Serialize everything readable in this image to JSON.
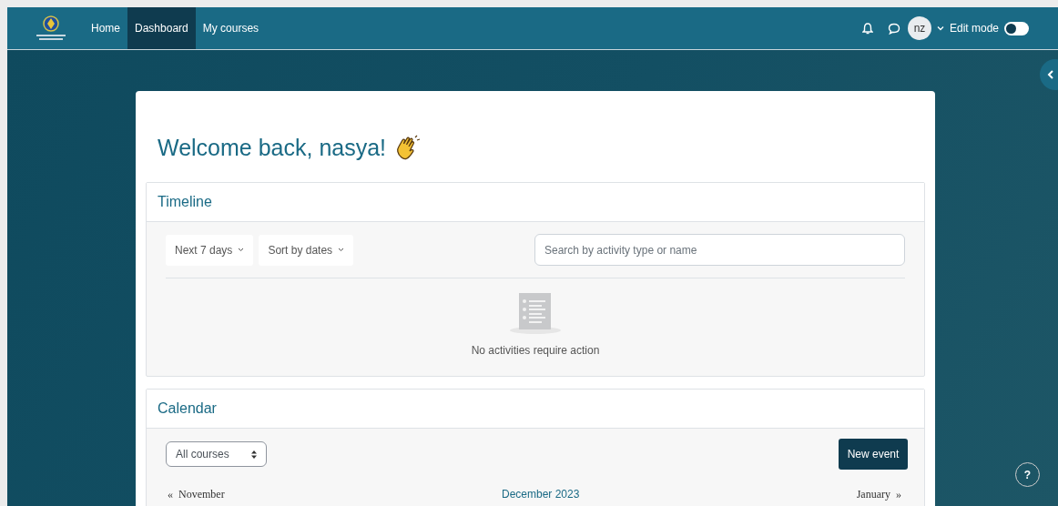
{
  "navbar": {
    "items": [
      {
        "label": "Home",
        "selected": false
      },
      {
        "label": "Dashboard",
        "selected": true
      },
      {
        "label": "My courses",
        "selected": false
      }
    ],
    "avatar": "nz",
    "edit_mode": {
      "label": "Edit mode",
      "on": false
    }
  },
  "welcome": "Welcome back, nasya!",
  "timeline": {
    "title": "Timeline",
    "filters": [
      "Next 7 days",
      "Sort by dates"
    ],
    "search": {
      "placeholder": "Search by activity type or name"
    },
    "empty_message": "No activities require action"
  },
  "calendar": {
    "title": "Calendar",
    "course_select": "All courses",
    "new_event": "New event",
    "prev": "«  November",
    "current": "December 2023",
    "next": "January  »"
  },
  "help": "?"
}
